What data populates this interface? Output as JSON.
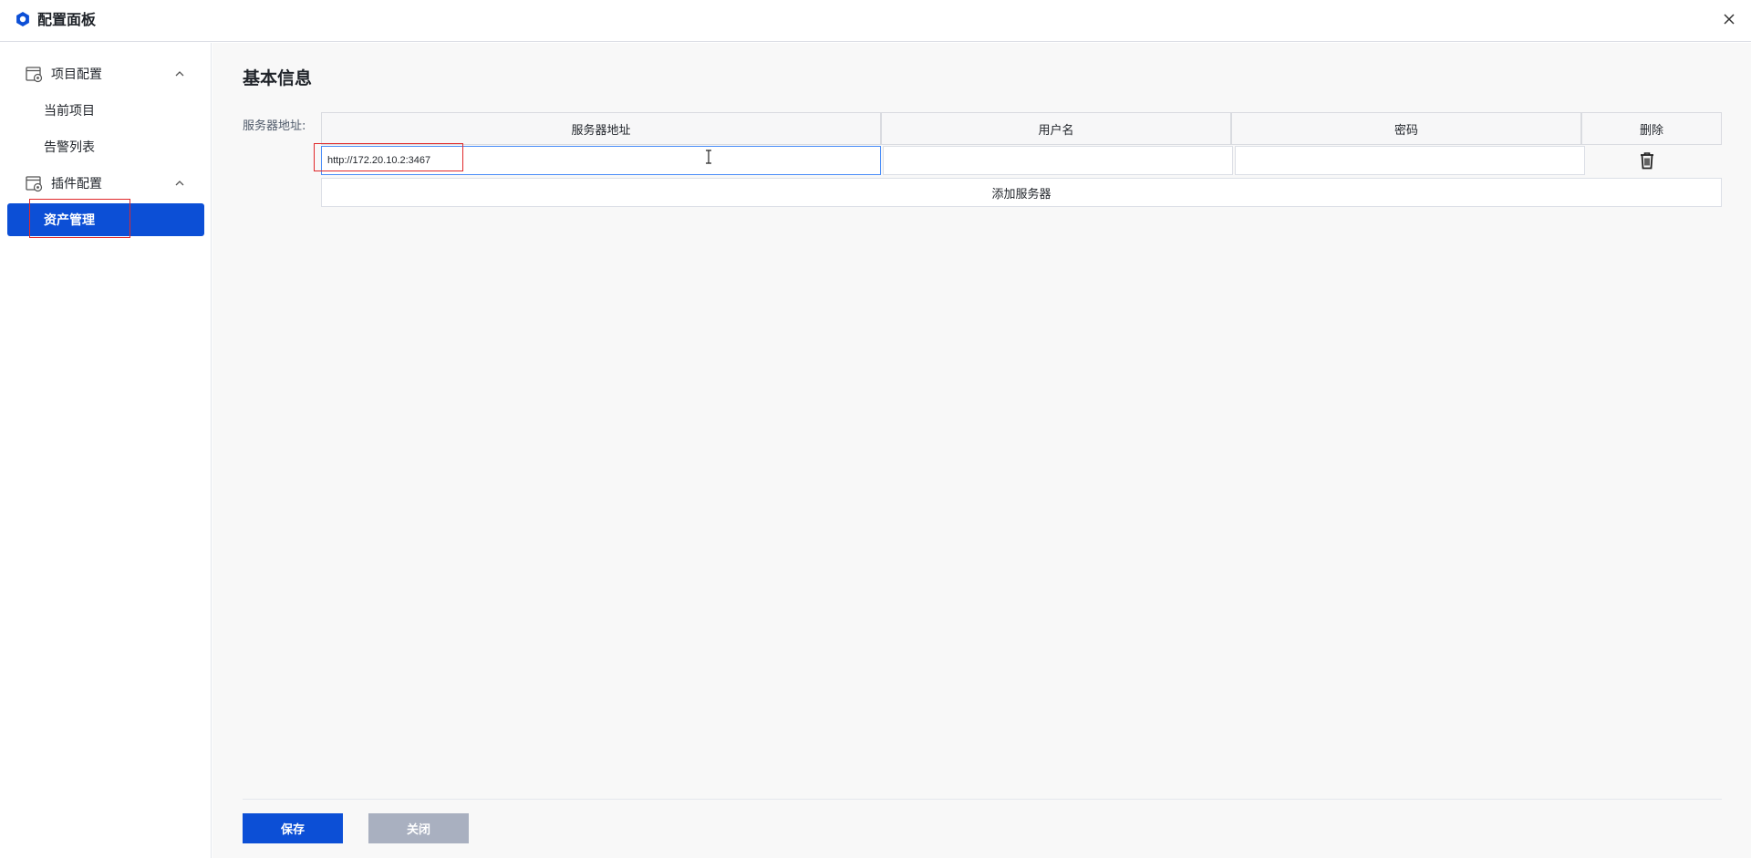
{
  "window": {
    "title": "配置面板"
  },
  "sidebar": {
    "groups": [
      {
        "label": "项目配置",
        "expanded": true,
        "items": [
          {
            "label": "当前项目"
          },
          {
            "label": "告警列表"
          }
        ]
      },
      {
        "label": "插件配置",
        "expanded": true,
        "items": [
          {
            "label": "资产管理",
            "active": true
          }
        ]
      }
    ]
  },
  "main": {
    "section_title": "基本信息",
    "field_label": "服务器地址:",
    "table": {
      "headers": [
        "服务器地址",
        "用户名",
        "密码",
        "删除"
      ],
      "rows": [
        {
          "address": "http://172.20.10.2:3467",
          "username": "",
          "password": ""
        }
      ],
      "add_label": "添加服务器"
    }
  },
  "footer": {
    "save_label": "保存",
    "close_label": "关闭"
  },
  "colors": {
    "primary": "#0c4fd6",
    "highlight": "#e0282a",
    "disabled_button": "#a9b0c0"
  }
}
